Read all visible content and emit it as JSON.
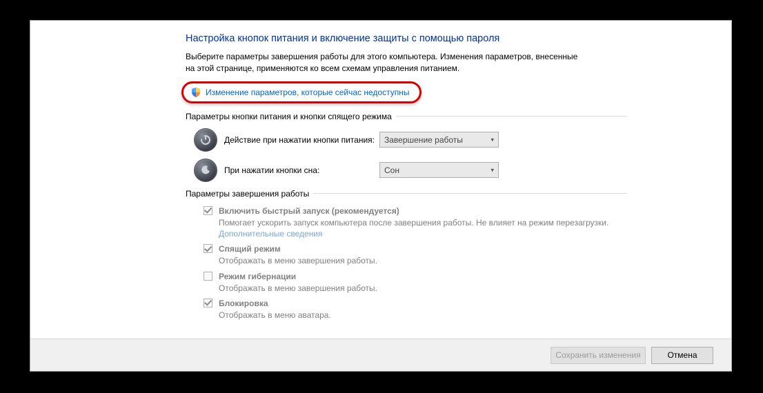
{
  "pageTitle": "Настройка кнопок питания и включение защиты с помощью пароля",
  "description": "Выберите параметры завершения работы для этого компьютера. Изменения параметров, внесенные на этой странице, применяются ко всем схемам управления питанием.",
  "uacLink": "Изменение параметров, которые сейчас недоступны",
  "sections": {
    "buttonsHeader": "Параметры кнопки питания и кнопки спящего режима",
    "shutdownHeader": "Параметры завершения работы"
  },
  "powerButtonRow": {
    "label": "Действие при нажатии кнопки питания:",
    "value": "Завершение работы"
  },
  "sleepButtonRow": {
    "label": "При нажатии кнопки сна:",
    "value": "Сон"
  },
  "checks": {
    "fastStart": {
      "label": "Включить быстрый запуск (рекомендуется)",
      "sub": "Помогает ускорить запуск компьютера после завершения работы. Не влияет на режим перезагрузки.",
      "link": "Дополнительные сведения"
    },
    "sleep": {
      "label": "Спящий режим",
      "sub": "Отображать в меню завершения работы."
    },
    "hibernate": {
      "label": "Режим гибернации",
      "sub": "Отображать в меню завершения работы."
    },
    "lock": {
      "label": "Блокировка",
      "sub": "Отображать в меню аватара."
    }
  },
  "footer": {
    "save": "Сохранить изменения",
    "cancel": "Отмена"
  }
}
